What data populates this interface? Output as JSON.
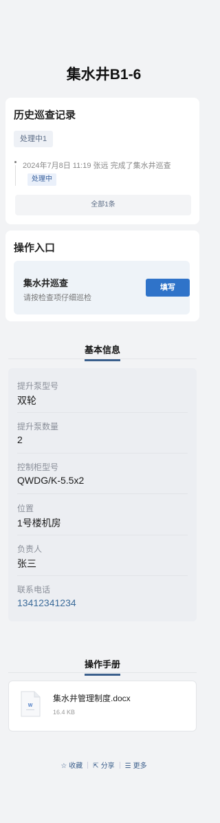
{
  "page": {
    "title": "集水井B1-6"
  },
  "history": {
    "title": "历史巡查记录",
    "filter_tag": "处理中1",
    "entries": [
      {
        "text": "2024年7月8日 11:19  张远  完成了集水井巡查",
        "status": "处理中"
      }
    ],
    "all_button": "全部1条"
  },
  "operations": {
    "title": "操作入口",
    "item": {
      "name": "集水井巡查",
      "desc": "请按检查项仔细巡检",
      "button": "填写"
    }
  },
  "basic_info": {
    "title": "基本信息",
    "rows": [
      {
        "label": "提升泵型号",
        "value": "双轮"
      },
      {
        "label": "提升泵数量",
        "value": "2"
      },
      {
        "label": "控制柜型号",
        "value": "QWDG/K-5.5x2"
      },
      {
        "label": "位置",
        "value": "1号楼机房"
      },
      {
        "label": "负责人",
        "value": "张三"
      },
      {
        "label": "联系电话",
        "value": "13412341234"
      }
    ]
  },
  "manual": {
    "title": "操作手册",
    "file": {
      "name": "集水井管理制度.docx",
      "size": "16.4 KB",
      "icon": "word-file-icon"
    }
  },
  "footer": {
    "favorite": "收藏",
    "favorite_icon": "star-icon",
    "share": "分享",
    "share_icon": "share-icon",
    "more": "更多",
    "more_icon": "menu-icon"
  },
  "colors": {
    "accent": "#2f73c9",
    "section_underline": "#3a5f8c",
    "phone": "#3b6b9a"
  }
}
